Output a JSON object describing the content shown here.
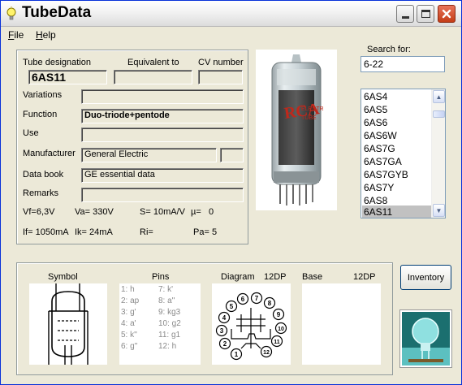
{
  "window": {
    "title": "TubeData"
  },
  "menu": {
    "file": {
      "mnemonic": "F",
      "rest": "ile"
    },
    "help": {
      "mnemonic": "H",
      "rest": "elp"
    }
  },
  "details": {
    "tube_designation_label": "Tube designation",
    "equivalent_label": "Equivalent to",
    "cv_label": "CV number",
    "tube_designation": "6AS11",
    "equivalent": "",
    "cv_number": "",
    "variations_label": "Variations",
    "variations": "",
    "function_label": "Function",
    "function": "Duo-triode+pentode",
    "use_label": "Use",
    "use": "",
    "manufacturer_label": "Manufacturer",
    "manufacturer": "General Electric",
    "manufacturer_extra": "",
    "databook_label": "Data book",
    "databook": "GE essential data",
    "remarks_label": "Remarks",
    "remarks": "",
    "params_row1": [
      {
        "name": "Vf=",
        "value": "6,3V"
      },
      {
        "name": "Va=",
        "value": "330V"
      },
      {
        "name": "S=",
        "value": "10mA/V"
      },
      {
        "name": "µ=",
        "value": "0"
      }
    ],
    "params_row2": [
      {
        "name": "If=",
        "value": "1050mA"
      },
      {
        "name": "Ik=",
        "value": "24mA"
      },
      {
        "name": "Ri=",
        "value": ""
      },
      {
        "name": "Pa=",
        "value": "5"
      }
    ]
  },
  "search": {
    "label": "Search for:",
    "value": "6-22",
    "results": [
      "6AS4",
      "6AS5",
      "6AS6",
      "6AS6W",
      "6AS7G",
      "6AS7GA",
      "6AS7GYB",
      "6AS7Y",
      "6AS8",
      "6AS11"
    ],
    "selected": "6AS11"
  },
  "bottom": {
    "symbol_label": "Symbol",
    "pins_label": "Pins",
    "diagram_label": "Diagram",
    "diagram_base": "12DP",
    "base_label": "Base",
    "base_value": "12DP",
    "pins_left": [
      "1: h",
      "2: ap",
      "3: g'",
      "4: a'",
      "5: k''",
      "6: g''"
    ],
    "pins_right": [
      "7: k'",
      "8: a''",
      "9: kg3",
      "10: g2",
      "11: g1",
      "12: h"
    ],
    "diagram_pins": [
      "1",
      "2",
      "3",
      "4",
      "5",
      "6",
      "7",
      "8",
      "9",
      "10",
      "11",
      "12"
    ]
  },
  "inventory_label": "Inventory",
  "colors": {
    "title_bar": "#f2f2f2",
    "close_button": "#c43c16",
    "selection": "#c1c1c1",
    "panel": "#ece9d8"
  }
}
